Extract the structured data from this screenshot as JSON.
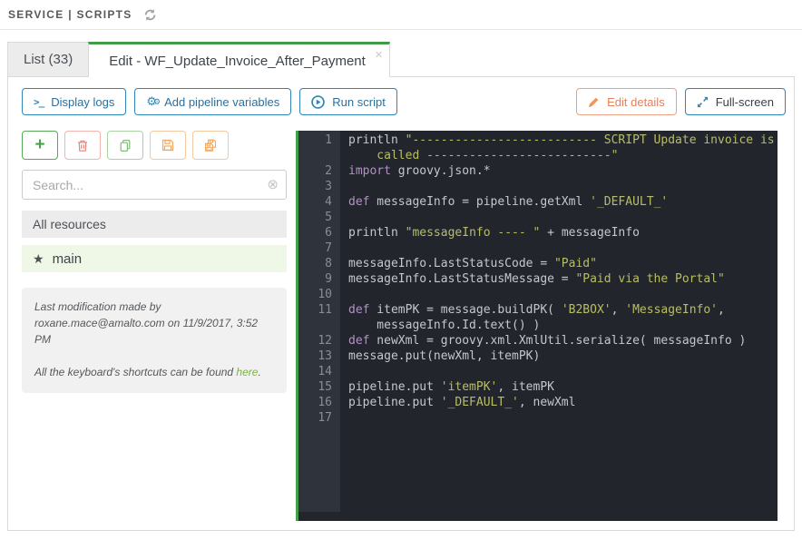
{
  "breadcrumb": {
    "text": "SERVICE | SCRIPTS"
  },
  "tabs": [
    {
      "label": "List (33)",
      "active": false
    },
    {
      "label": "Edit - WF_Update_Invoice_After_Payment",
      "active": true,
      "close": "×"
    }
  ],
  "toolbar": {
    "display_logs": "Display logs",
    "add_pipeline_variables": "Add pipeline variables",
    "run_script": "Run script",
    "edit_details": "Edit details",
    "full_screen": "Full-screen"
  },
  "sidebar": {
    "icon_buttons": [
      {
        "name": "add",
        "icon": "plus-icon"
      },
      {
        "name": "delete",
        "icon": "trash-icon"
      },
      {
        "name": "duplicate",
        "icon": "copy-icon"
      },
      {
        "name": "save",
        "icon": "floppy-icon"
      },
      {
        "name": "save-all",
        "icon": "floppies-icon"
      }
    ],
    "search_placeholder": "Search...",
    "list_header": "All resources",
    "items": [
      {
        "label": "main",
        "starred": true,
        "selected": true
      }
    ],
    "info": {
      "modification": "Last modification made by roxane.mace@amalto.com on 11/9/2017, 3:52 PM",
      "shortcuts_prefix": "All the keyboard's shortcuts can be found ",
      "shortcuts_link": "here",
      "shortcuts_suffix": "."
    }
  },
  "editor": {
    "language": "groovy",
    "rows": [
      {
        "n": "1",
        "s": [
          {
            "c": "d",
            "t": "println "
          },
          {
            "c": "s",
            "t": "\"-------------------------- SCRIPT Update invoice is"
          }
        ]
      },
      {
        "n": "",
        "s": [
          {
            "c": "s",
            "t": "    called --------------------------\""
          }
        ]
      },
      {
        "n": "2",
        "s": [
          {
            "c": "k",
            "t": "import"
          },
          {
            "c": "d",
            "t": " groovy.json.*"
          }
        ]
      },
      {
        "n": "3",
        "s": []
      },
      {
        "n": "4",
        "s": [
          {
            "c": "k",
            "t": "def"
          },
          {
            "c": "d",
            "t": " messageInfo = pipeline.getXml "
          },
          {
            "c": "s",
            "t": "'_DEFAULT_'"
          }
        ]
      },
      {
        "n": "5",
        "s": []
      },
      {
        "n": "6",
        "s": [
          {
            "c": "d",
            "t": "println "
          },
          {
            "c": "s",
            "t": "\"messageInfo ---- \""
          },
          {
            "c": "d",
            "t": " + messageInfo"
          }
        ]
      },
      {
        "n": "7",
        "s": []
      },
      {
        "n": "8",
        "s": [
          {
            "c": "d",
            "t": "messageInfo.LastStatusCode = "
          },
          {
            "c": "s",
            "t": "\"Paid\""
          }
        ]
      },
      {
        "n": "9",
        "s": [
          {
            "c": "d",
            "t": "messageInfo.LastStatusMessage = "
          },
          {
            "c": "s",
            "t": "\"Paid via the Portal\""
          }
        ]
      },
      {
        "n": "10",
        "s": []
      },
      {
        "n": "11",
        "s": [
          {
            "c": "k",
            "t": "def"
          },
          {
            "c": "d",
            "t": " itemPK = message.buildPK( "
          },
          {
            "c": "s",
            "t": "'B2BOX'"
          },
          {
            "c": "d",
            "t": ", "
          },
          {
            "c": "s",
            "t": "'MessageInfo'"
          },
          {
            "c": "d",
            "t": ","
          }
        ]
      },
      {
        "n": "",
        "s": [
          {
            "c": "d",
            "t": "    messageInfo.Id.text() )"
          }
        ]
      },
      {
        "n": "12",
        "s": [
          {
            "c": "k",
            "t": "def"
          },
          {
            "c": "d",
            "t": " newXml = groovy.xml.XmlUtil.serialize( messageInfo )"
          }
        ]
      },
      {
        "n": "13",
        "s": [
          {
            "c": "d",
            "t": "message.put(newXml, itemPK)"
          }
        ]
      },
      {
        "n": "14",
        "s": []
      },
      {
        "n": "15",
        "s": [
          {
            "c": "d",
            "t": "pipeline.put "
          },
          {
            "c": "s",
            "t": "'itemPK'"
          },
          {
            "c": "d",
            "t": ", itemPK"
          }
        ]
      },
      {
        "n": "16",
        "s": [
          {
            "c": "d",
            "t": "pipeline.put "
          },
          {
            "c": "s",
            "t": "'_DEFAULT_'"
          },
          {
            "c": "d",
            "t": ", newXml"
          }
        ]
      },
      {
        "n": "17",
        "s": []
      }
    ]
  },
  "colors": {
    "accent_green": "#3f9c47",
    "accent_blue": "#2e86b8",
    "accent_orange": "#eda184",
    "editor_bg": "#22262c",
    "editor_gutter_bg": "#2e333c",
    "code_default": "#c3c8ce",
    "code_keyword": "#b68fc9",
    "code_string": "#b8bd66"
  }
}
